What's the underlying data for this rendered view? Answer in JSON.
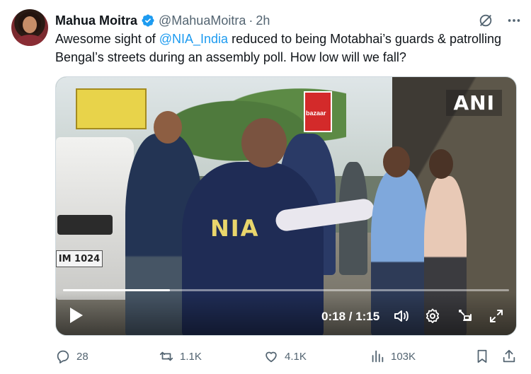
{
  "author": {
    "name": "Mahua Moitra",
    "handle": "@MahuaMoitra",
    "separator": "·",
    "time": "2h"
  },
  "tweet": {
    "text_before": "Awesome sight of ",
    "mention": "@NIA_India",
    "text_after": "  reduced to being Motabhai’s guards & patrolling Bengal’s streets during an assembly poll. How low will we fall?"
  },
  "video": {
    "watermark": "ANI",
    "overlay_text": "NIA",
    "plate_text": "IM 1024",
    "billboard_text": "bazaar",
    "timecode": "0:18 / 1:15",
    "progress": 0.24,
    "controls": [
      "play-icon",
      "volume-icon",
      "settings-icon",
      "pip-icon",
      "fullscreen-icon"
    ]
  },
  "actions": {
    "replies": "28",
    "reposts": "1.1K",
    "likes": "4.1K",
    "views": "103K"
  },
  "colors": {
    "accent": "#1d9bf0",
    "text_secondary": "#536471",
    "verified": "#1d9bf0"
  }
}
